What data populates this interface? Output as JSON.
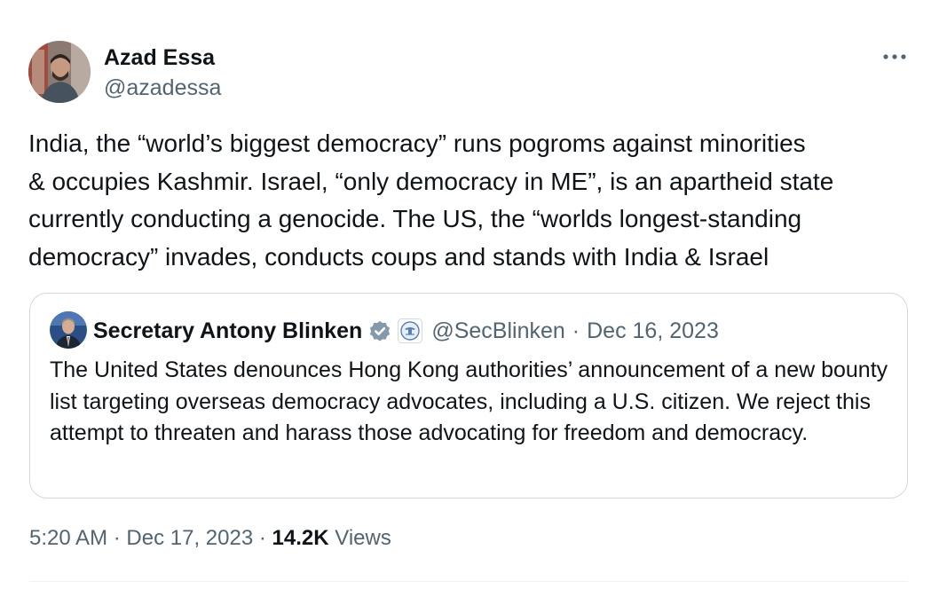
{
  "author": {
    "name": "Azad Essa",
    "handle": "@azadessa"
  },
  "tweet": {
    "text": "India, the “world’s biggest democracy” runs pogroms against minorities\n& occupies Kashmir. Israel, “only democracy in ME”, is an apartheid state\ncurrently conducting a genocide. The US, the “worlds longest-standing\ndemocracy” invades, conducts coups and stands with India & Israel"
  },
  "quoted_tweet": {
    "author_name": "Secretary Antony Blinken",
    "handle": "@SecBlinken",
    "separator": "·",
    "date": "Dec 16, 2023",
    "text": "The United States denounces Hong Kong authorities’ announcement of a new bounty list targeting overseas democracy advocates, including a U.S. citizen. We reject this attempt to threaten and harass those advocating for freedom and democracy."
  },
  "meta": {
    "time": "5:20 AM",
    "separator_1": "·",
    "date": "Dec 17, 2023",
    "separator_2": "·",
    "views_count": "14.2K",
    "views_label": "Views"
  },
  "colors": {
    "text_primary": "#0f1419",
    "text_secondary": "#536471",
    "border": "#cfd9de",
    "verified_gray": "#829aab"
  },
  "icons": {
    "more": "more-horizontal-icon",
    "verified": "verified-badge-icon",
    "affiliation": "state-department-seal-icon"
  }
}
